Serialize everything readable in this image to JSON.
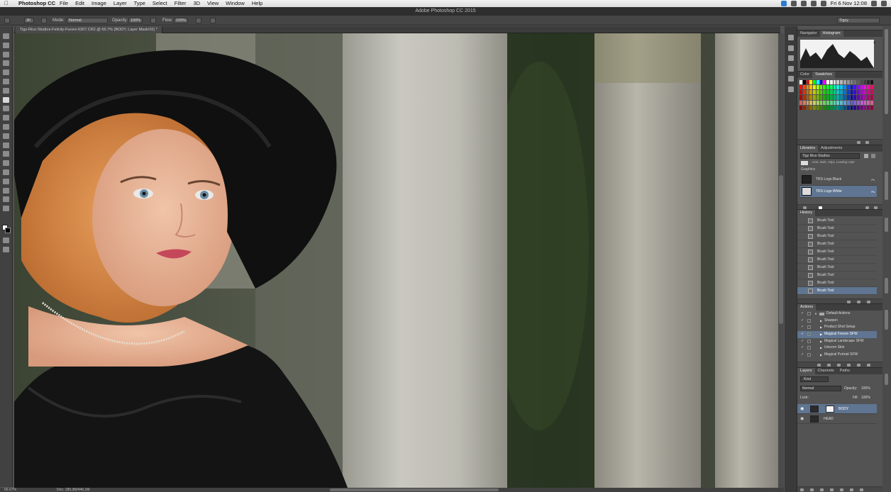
{
  "menubar": {
    "app_name": "Photoshop CC",
    "items": [
      "File",
      "Edit",
      "Image",
      "Layer",
      "Type",
      "Select",
      "Filter",
      "3D",
      "View",
      "Window",
      "Help"
    ],
    "clock": "Fri 6 Nov 12:08"
  },
  "window": {
    "title": "Adobe Photoshop CC 2015"
  },
  "options_bar": {
    "brush_size": "30",
    "mode_label": "Mode:",
    "mode_value": "Normal",
    "opacity_label": "Opacity:",
    "opacity_value": "100%",
    "flow_label": "Flow:",
    "flow_value": "100%",
    "workspace": "Tigzy"
  },
  "document": {
    "tab_label": "Tigz-Rice-Studios-Felicity-Furore-6307.CR2 @ 66.7% (BODY, Layer Mask/16) *",
    "zoom": "66.67%",
    "doc_size": "Doc: 180.3M/446.1M"
  },
  "panels": {
    "navigator": {
      "tabs": [
        "Navigator",
        "Histogram"
      ],
      "active": 1
    },
    "color": {
      "tabs": [
        "Color",
        "Swatches"
      ],
      "active": 1
    },
    "libraries": {
      "tabs": [
        "Libraries",
        "Adjustments"
      ],
      "library_name": "Tigz Rice Studios",
      "char_style": "Arial, Italic, 24pt, Leading 24pt",
      "section": "Graphics",
      "items": [
        {
          "name": "TRS Logo Black",
          "badge": "Ps",
          "selected": false
        },
        {
          "name": "TRS Logo White",
          "badge": "Ps",
          "selected": true
        }
      ]
    },
    "history": {
      "tabs": [
        "History"
      ],
      "items": [
        "Brush Tool",
        "Brush Tool",
        "Brush Tool",
        "Brush Tool",
        "Brush Tool",
        "Brush Tool",
        "Brush Tool",
        "Brush Tool",
        "Brush Tool",
        "Brush Tool"
      ]
    },
    "actions": {
      "tabs": [
        "Actions"
      ],
      "items": [
        {
          "name": "Default Actions",
          "folder": true,
          "selected": false
        },
        {
          "name": "Sharpen",
          "folder": false,
          "selected": false
        },
        {
          "name": "Product Shot Setup",
          "folder": false,
          "selected": false
        },
        {
          "name": "Magical Freeze SFW",
          "folder": false,
          "selected": true
        },
        {
          "name": "Magical Landscape SFW",
          "folder": false,
          "selected": false
        },
        {
          "name": "Unicorn Skin",
          "folder": false,
          "selected": false
        },
        {
          "name": "Magical Portrait SFW",
          "folder": false,
          "selected": false
        }
      ]
    },
    "layers": {
      "tabs": [
        "Layers",
        "Channels",
        "Paths"
      ],
      "kind_label": "Kind",
      "blend_mode": "Normal",
      "opacity_label": "Opacity:",
      "opacity_value": "100%",
      "lock_label": "Lock:",
      "fill_label": "Fill:",
      "fill_value": "100%",
      "items": [
        {
          "name": "BODY",
          "selected": true
        },
        {
          "name": "HEAD",
          "selected": false
        }
      ]
    }
  },
  "colors": {
    "accent": "#5f7591",
    "panel": "#535353",
    "chrome": "#414141"
  }
}
